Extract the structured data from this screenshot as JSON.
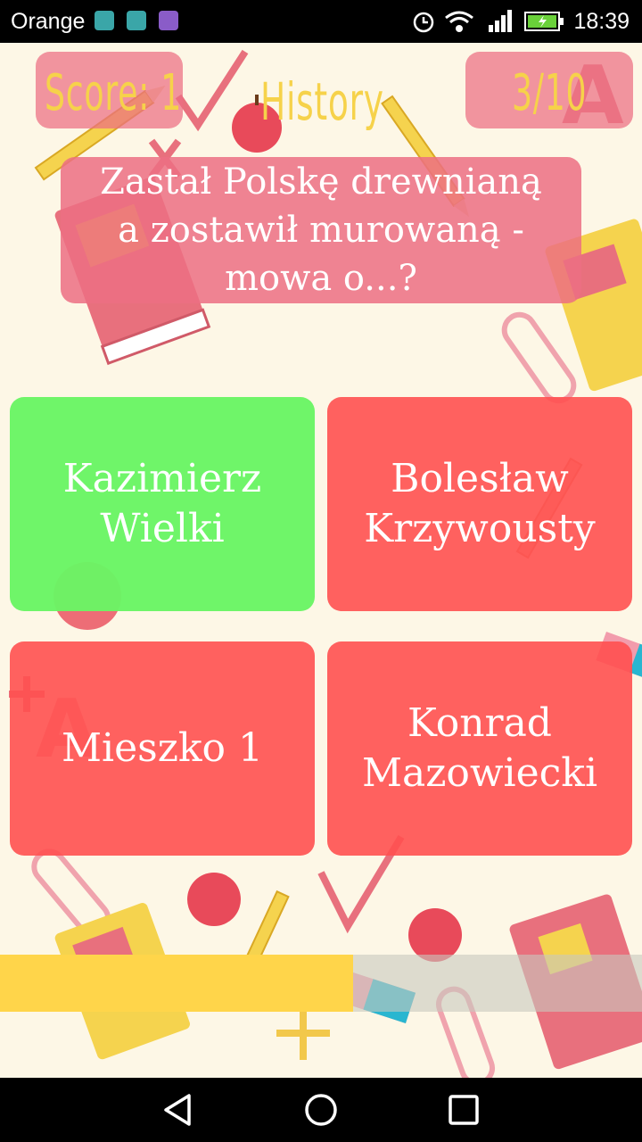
{
  "status_bar": {
    "carrier": "Orange",
    "time": "18:39",
    "icons": [
      "android-icon",
      "shield-icon",
      "image-icon",
      "alarm-icon",
      "wifi-icon",
      "signal-icon",
      "battery-charging-icon"
    ]
  },
  "header": {
    "score": "Score: 1",
    "category": "History",
    "counter": "3/10"
  },
  "question": {
    "text": "Zastał Polskę drewnianą a zostawił murowaną - mowa o...?"
  },
  "answers": [
    {
      "label": "Kazimierz Wielki",
      "state": "correct"
    },
    {
      "label": "Bolesław Krzywousty",
      "state": "wrong"
    },
    {
      "label": "Mieszko 1",
      "state": "wrong"
    },
    {
      "label": "Konrad Mazowiecki",
      "state": "wrong"
    }
  ],
  "timer": {
    "progress": 0.55
  },
  "colors": {
    "correct": "#6af564",
    "wrong": "#ff5050",
    "header_text": "#f6d24a",
    "progress_fill": "#ffd54a",
    "background": "#fdf7e6"
  },
  "nav": {
    "icons": [
      "back-icon",
      "home-icon",
      "recents-icon"
    ]
  }
}
